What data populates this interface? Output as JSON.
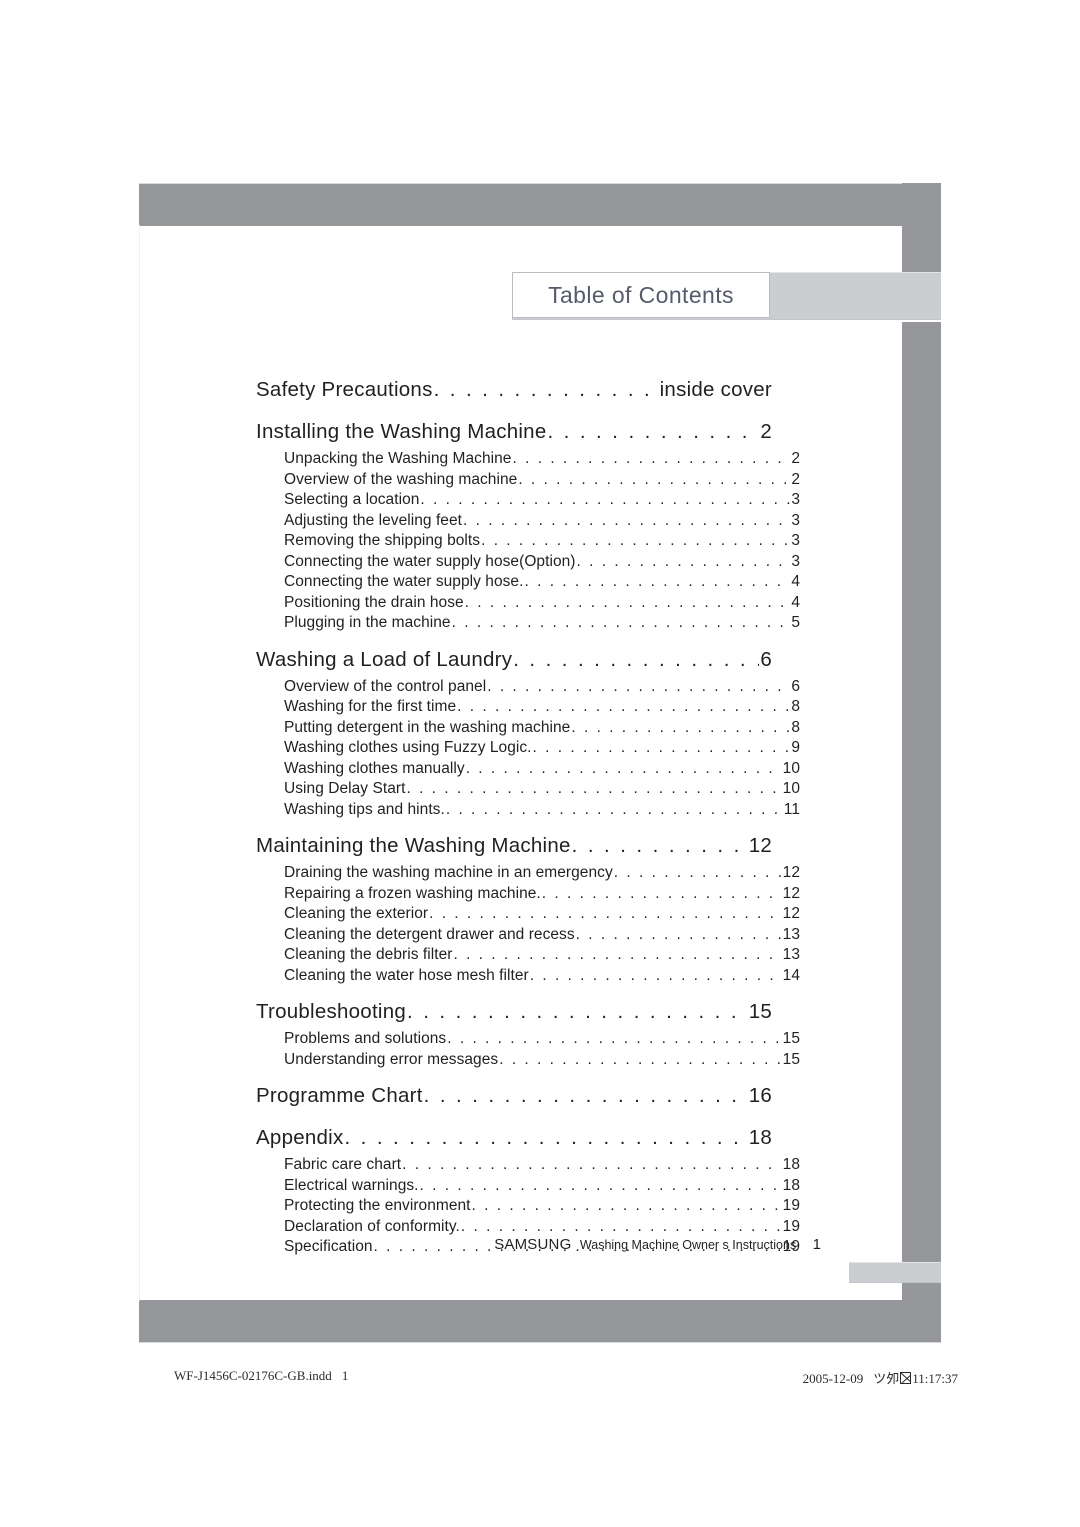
{
  "header": {
    "title": "Table of Contents"
  },
  "toc": {
    "groups": [
      {
        "main": {
          "label": "Safety Precautions",
          "page": "inside cover"
        },
        "subs": []
      },
      {
        "main": {
          "label": "Installing the Washing Machine",
          "page": "2"
        },
        "subs": [
          {
            "label": "Unpacking the Washing Machine",
            "page": "2"
          },
          {
            "label": "Overview of the washing machine",
            "page": "2"
          },
          {
            "label": "Selecting a location",
            "page": "3"
          },
          {
            "label": "Adjusting the leveling feet",
            "page": "3"
          },
          {
            "label": "Removing the shipping bolts",
            "page": "3"
          },
          {
            "label": "Connecting the water supply hose(Option)",
            "page": "3"
          },
          {
            "label": "Connecting the water supply hose.",
            "page": "4"
          },
          {
            "label": "Positioning the drain hose",
            "page": "4"
          },
          {
            "label": "Plugging in the machine",
            "page": "5"
          }
        ]
      },
      {
        "main": {
          "label": "Washing a Load of Laundry",
          "page": "6"
        },
        "subs": [
          {
            "label": "Overview of the control panel",
            "page": "6"
          },
          {
            "label": "Washing for the first time",
            "page": "8"
          },
          {
            "label": "Putting detergent in the washing machine",
            "page": "8"
          },
          {
            "label": "Washing clothes using Fuzzy Logic.",
            "page": "9"
          },
          {
            "label": "Washing clothes manually",
            "page": "10"
          },
          {
            "label": "Using Delay Start",
            "page": "10"
          },
          {
            "label": "Washing tips and hints.",
            "page": "11"
          }
        ]
      },
      {
        "main": {
          "label": "Maintaining the Washing Machine",
          "page": "12"
        },
        "subs": [
          {
            "label": "Draining the washing machine in an emergency",
            "page": "12"
          },
          {
            "label": "Repairing a frozen washing machine.",
            "page": "12"
          },
          {
            "label": "Cleaning the exterior",
            "page": "12"
          },
          {
            "label": "Cleaning the detergent drawer and recess",
            "page": "13"
          },
          {
            "label": "Cleaning the debris filter",
            "page": "13"
          },
          {
            "label": "Cleaning the water hose mesh filter",
            "page": "14"
          }
        ]
      },
      {
        "main": {
          "label": "Troubleshooting",
          "page": "15"
        },
        "subs": [
          {
            "label": "Problems and solutions",
            "page": "15"
          },
          {
            "label": "Understanding error messages",
            "page": "15"
          }
        ]
      },
      {
        "main": {
          "label": "Programme Chart",
          "page": "16"
        },
        "subs": []
      },
      {
        "main": {
          "label": "Appendix",
          "page": "18"
        },
        "subs": [
          {
            "label": "Fabric care chart",
            "page": "18"
          },
          {
            "label": "Electrical warnings.",
            "page": "18"
          },
          {
            "label": "Protecting the environment",
            "page": "19"
          },
          {
            "label": "Declaration of conformity.",
            "page": "19"
          },
          {
            "label": "Specification",
            "page": "19"
          }
        ]
      }
    ]
  },
  "page_footer": {
    "brand": "SAMSUNG",
    "text": "Washing Machine Owner s Instructions",
    "page_number": "1"
  },
  "print_marks": {
    "file_name": "WF-J1456C-02176C-GB.indd",
    "file_page": "1",
    "date": "2005-12-09",
    "meridiem": "ツ夘",
    "time": "11:17:37"
  },
  "colors": {
    "frame_gray": "#95979a",
    "band_gray": "#cbcdd0",
    "title_text": "#565b6b",
    "body_text": "#231f20"
  }
}
